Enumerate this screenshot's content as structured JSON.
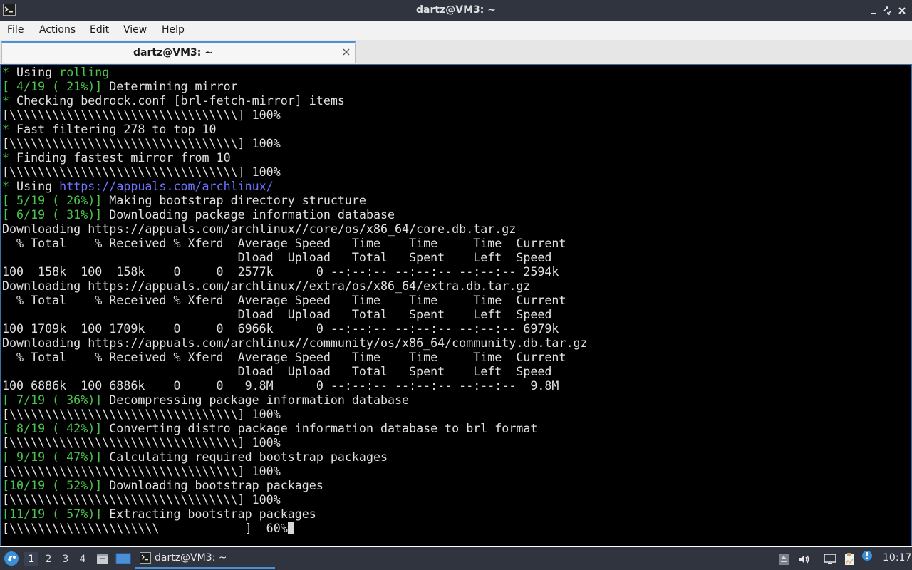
{
  "window": {
    "title": "dartz@VM3: ~"
  },
  "menu": {
    "items": [
      "File",
      "Actions",
      "Edit",
      "View",
      "Help"
    ]
  },
  "tab": {
    "label": "dartz@VM3: ~"
  },
  "terminal": {
    "lines": [
      [
        [
          "g",
          "* "
        ],
        [
          "",
          "Using "
        ],
        [
          "g",
          "rolling"
        ]
      ],
      [
        [
          "g",
          "[ 4/19 ( 21%)]"
        ],
        [
          "",
          " Determining mirror"
        ]
      ],
      [
        [
          "g",
          "* "
        ],
        [
          "",
          "Checking bedrock.conf [brl-fetch-mirror] items"
        ]
      ],
      [
        [
          "",
          "[\\\\\\\\\\\\\\\\\\\\\\\\\\\\\\\\\\\\\\\\\\\\\\\\\\\\\\\\\\\\\\\\] 100%"
        ]
      ],
      [
        [
          "g",
          "* "
        ],
        [
          "",
          "Fast filtering 278 to top 10"
        ]
      ],
      [
        [
          "",
          "[\\\\\\\\\\\\\\\\\\\\\\\\\\\\\\\\\\\\\\\\\\\\\\\\\\\\\\\\\\\\\\\\] 100%"
        ]
      ],
      [
        [
          "g",
          "* "
        ],
        [
          "",
          "Finding fastest mirror from 10"
        ]
      ],
      [
        [
          "",
          "[\\\\\\\\\\\\\\\\\\\\\\\\\\\\\\\\\\\\\\\\\\\\\\\\\\\\\\\\\\\\\\\\] 100%"
        ]
      ],
      [
        [
          "g",
          "* "
        ],
        [
          "",
          "Using "
        ],
        [
          "b",
          "https://appuals.com/archlinux/"
        ]
      ],
      [
        [
          "g",
          "[ 5/19 ( 26%)]"
        ],
        [
          "",
          " Making bootstrap directory structure"
        ]
      ],
      [
        [
          "g",
          "[ 6/19 ( 31%)]"
        ],
        [
          "",
          " Downloading package information database"
        ]
      ],
      [
        [
          "",
          "Downloading https://appuals.com/archlinux//core/os/x86_64/core.db.tar.gz"
        ]
      ],
      [
        [
          "",
          "  % Total    % Received % Xferd  Average Speed   Time    Time     Time  Current"
        ]
      ],
      [
        [
          "",
          "                                 Dload  Upload   Total   Spent    Left  Speed"
        ]
      ],
      [
        [
          "",
          "100  158k  100  158k    0     0  2577k      0 --:--:-- --:--:-- --:--:-- 2594k"
        ]
      ],
      [
        [
          "",
          "Downloading https://appuals.com/archlinux//extra/os/x86_64/extra.db.tar.gz"
        ]
      ],
      [
        [
          "",
          "  % Total    % Received % Xferd  Average Speed   Time    Time     Time  Current"
        ]
      ],
      [
        [
          "",
          "                                 Dload  Upload   Total   Spent    Left  Speed"
        ]
      ],
      [
        [
          "",
          "100 1709k  100 1709k    0     0  6966k      0 --:--:-- --:--:-- --:--:-- 6979k"
        ]
      ],
      [
        [
          "",
          "Downloading https://appuals.com/archlinux//community/os/x86_64/community.db.tar.gz"
        ]
      ],
      [
        [
          "",
          "  % Total    % Received % Xferd  Average Speed   Time    Time     Time  Current"
        ]
      ],
      [
        [
          "",
          "                                 Dload  Upload   Total   Spent    Left  Speed"
        ]
      ],
      [
        [
          "",
          "100 6886k  100 6886k    0     0   9.8M      0 --:--:-- --:--:-- --:--:--  9.8M"
        ]
      ],
      [
        [
          "g",
          "[ 7/19 ( 36%)]"
        ],
        [
          "",
          " Decompressing package information database"
        ]
      ],
      [
        [
          "",
          "[\\\\\\\\\\\\\\\\\\\\\\\\\\\\\\\\\\\\\\\\\\\\\\\\\\\\\\\\\\\\\\\\] 100%"
        ]
      ],
      [
        [
          "g",
          "[ 8/19 ( 42%)]"
        ],
        [
          "",
          " Converting distro package information database to brl format"
        ]
      ],
      [
        [
          "",
          "[\\\\\\\\\\\\\\\\\\\\\\\\\\\\\\\\\\\\\\\\\\\\\\\\\\\\\\\\\\\\\\\\] 100%"
        ]
      ],
      [
        [
          "g",
          "[ 9/19 ( 47%)]"
        ],
        [
          "",
          " Calculating required bootstrap packages"
        ]
      ],
      [
        [
          "",
          "[\\\\\\\\\\\\\\\\\\\\\\\\\\\\\\\\\\\\\\\\\\\\\\\\\\\\\\\\\\\\\\\\] 100%"
        ]
      ],
      [
        [
          "g",
          "[10/19 ( 52%)]"
        ],
        [
          "",
          " Downloading bootstrap packages"
        ]
      ],
      [
        [
          "",
          "[\\\\\\\\\\\\\\\\\\\\\\\\\\\\\\\\\\\\\\\\\\\\\\\\\\\\\\\\\\\\\\\\] 100%"
        ]
      ],
      [
        [
          "g",
          "[11/19 ( 57%)]"
        ],
        [
          "",
          " Extracting bootstrap packages"
        ]
      ],
      [
        [
          "",
          "[\\\\\\\\\\\\\\\\\\\\\\\\\\\\\\\\\\\\\\\\\\            ]  60%"
        ]
      ]
    ],
    "cursor_after_last_line": true
  },
  "taskbar": {
    "workspaces": [
      "1",
      "2",
      "3",
      "4"
    ],
    "active_workspace": "1",
    "task_label": "dartz@VM3: ~",
    "clock": "10:17",
    "tray_icons": [
      "eject-icon",
      "volume-icon",
      "network-icon",
      "clipboard-icon",
      "update-notifier-icon"
    ]
  },
  "colors": {
    "terminal_bg": "#000000",
    "terminal_fg": "#e0e0e0",
    "prompt_green": "#4cc34c",
    "link_blue": "#6f74ff",
    "panel_bg": "#2f343f",
    "accent": "#4a90d9"
  }
}
